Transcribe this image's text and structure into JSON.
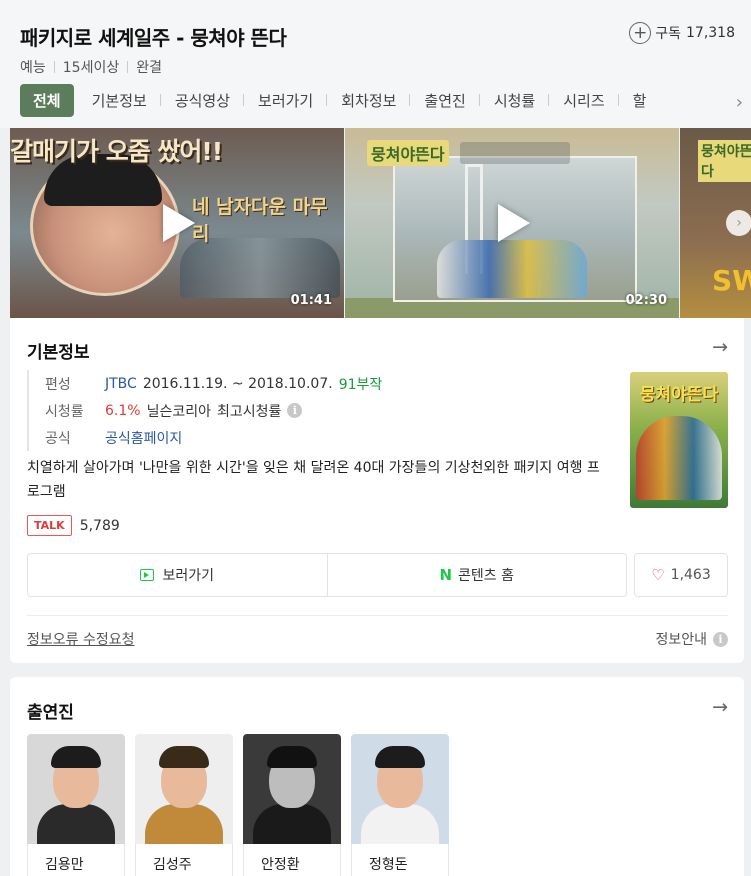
{
  "header": {
    "title": "패키지로 세계일주 - 뭉쳐야 뜬다",
    "subscribe_label": "구독",
    "subscribe_count": "17,318",
    "meta": [
      "예능",
      "15세이상",
      "완결"
    ]
  },
  "tabs": [
    {
      "label": "전체",
      "active": true
    },
    {
      "label": "기본정보"
    },
    {
      "label": "공식영상"
    },
    {
      "label": "보러가기"
    },
    {
      "label": "회차정보"
    },
    {
      "label": "출연진"
    },
    {
      "label": "시청률"
    },
    {
      "label": "시리즈"
    },
    {
      "label": "할"
    }
  ],
  "videos": [
    {
      "duration": "01:41",
      "overlay_text": "갈매기가 오줌 쌌어!!",
      "sub_text": "네 남자다운 마무리"
    },
    {
      "duration": "02:30",
      "logo_text": "뭉쳐야뜬다"
    },
    {
      "logo_text": "뭉쳐야뜬다",
      "overlay_text": "SW"
    }
  ],
  "info": {
    "section_title": "기본정보",
    "rows": {
      "channel_label": "편성",
      "channel": "JTBC",
      "period": "2016.11.19. ~ 2018.10.07.",
      "episodes": "91부작",
      "rating_label": "시청률",
      "rating": "6.1%",
      "rating_source": "닐슨코리아",
      "rating_note": "최고시청률",
      "official_label": "공식",
      "official_link": "공식홈페이지"
    },
    "description": "치열하게 살아가며 '나만을 위한 시간'을 잊은 채 달려온 40대 가장들의 기상천외한 패키지 여행 프로그램",
    "poster_text": "뭉쳐야뜬다",
    "talk_badge": "TALK",
    "talk_count": "5,789",
    "buttons": {
      "watch": "보러가기",
      "content_home_icon": "N",
      "content_home": "콘텐츠 홈",
      "like_count": "1,463"
    },
    "report_link": "정보오류 수정요청",
    "info_guide": "정보안내"
  },
  "cast": {
    "section_title": "출연진",
    "members": [
      {
        "name": "김용만"
      },
      {
        "name": "김성주"
      },
      {
        "name": "안정환"
      },
      {
        "name": "정형돈"
      }
    ]
  },
  "colors": {
    "tab_active_bg": "#5b7d5c",
    "link": "#2a57a8",
    "green": "#1a9a3a",
    "red": "#e03a3a",
    "naver_green": "#1ec84a"
  },
  "icons": {
    "subscribe": "plus-circle-icon",
    "tab_scroll": "chevron-right-icon",
    "section_more": "arrow-right-icon",
    "play": "play-icon",
    "info": "info-icon",
    "watch": "video-play-icon",
    "like": "heart-icon"
  }
}
